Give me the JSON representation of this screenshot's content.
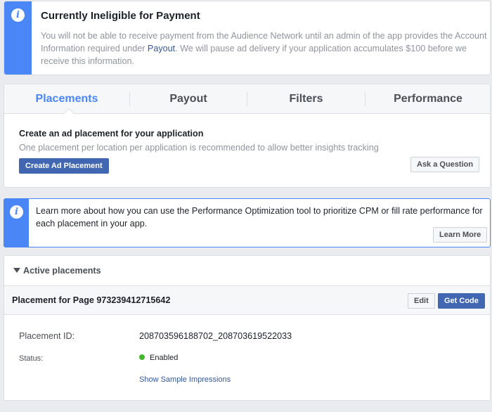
{
  "notice": {
    "icon": "info-icon",
    "title": "Currently Ineligible for Payment",
    "body_before": "You will not be able to receive payment from the Audience Network until an admin of the app provides the Account Information required under ",
    "link": "Payout",
    "body_after": ". We will pause ad delivery if your application accumulates $100 before we receive this information."
  },
  "tabs": [
    {
      "label": "Placements",
      "active": true
    },
    {
      "label": "Payout",
      "active": false
    },
    {
      "label": "Filters",
      "active": false
    },
    {
      "label": "Performance",
      "active": false
    }
  ],
  "create": {
    "title": "Create an ad placement for your application",
    "subtitle": "One placement per location per application is recommended to allow better insights tracking",
    "button": "Create Ad Placement",
    "ask_button": "Ask a Question"
  },
  "tip": {
    "icon": "info-icon",
    "text": "Learn more about how you can use the Performance Optimization tool to prioritize CPM or fill rate performance for each placement in your app.",
    "button": "Learn More"
  },
  "placements": {
    "section_label": "Active placements",
    "item": {
      "name": "Placement for Page 973239412715642",
      "edit_button": "Edit",
      "get_code_button": "Get Code",
      "id_label": "Placement ID:",
      "id_value": "208703596188702_208703619522033",
      "status_label": "Status:",
      "status_value": "Enabled",
      "sample_link": "Show Sample Impressions"
    }
  },
  "colors": {
    "accent": "#4a86f5",
    "primary_button": "#4267b2",
    "link": "#365899",
    "status_enabled": "#42b72a"
  }
}
